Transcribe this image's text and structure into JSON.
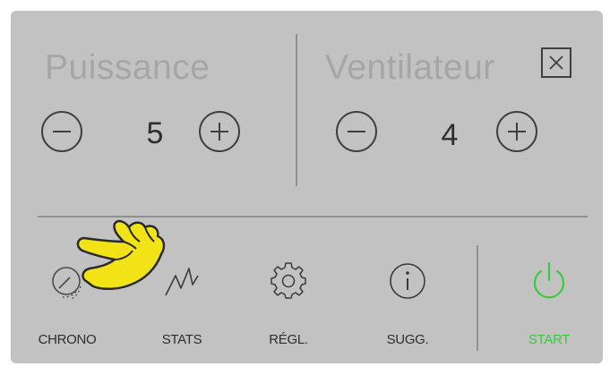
{
  "power": {
    "title": "Puissance",
    "value": "5",
    "decrement_icon": "minus-icon",
    "increment_icon": "plus-icon"
  },
  "fan": {
    "title": "Ventilateur",
    "value": "4",
    "decrement_icon": "minus-icon",
    "increment_icon": "plus-icon"
  },
  "close_icon": "close-icon",
  "toolbar": {
    "items": [
      {
        "label": "CHRONO",
        "icon": "timer-icon"
      },
      {
        "label": "STATS",
        "icon": "stats-icon"
      },
      {
        "label": "RÉGL.",
        "icon": "gear-icon"
      },
      {
        "label": "SUGG.",
        "icon": "info-icon"
      }
    ],
    "start": {
      "label": "START",
      "icon": "power-icon"
    }
  },
  "colors": {
    "panel_background": "#c2c2c2",
    "title_text": "#a6a6a6",
    "outline": "#3f3f3f",
    "start_accent": "#3ec83e",
    "pointer_fill": "#f2e317"
  }
}
